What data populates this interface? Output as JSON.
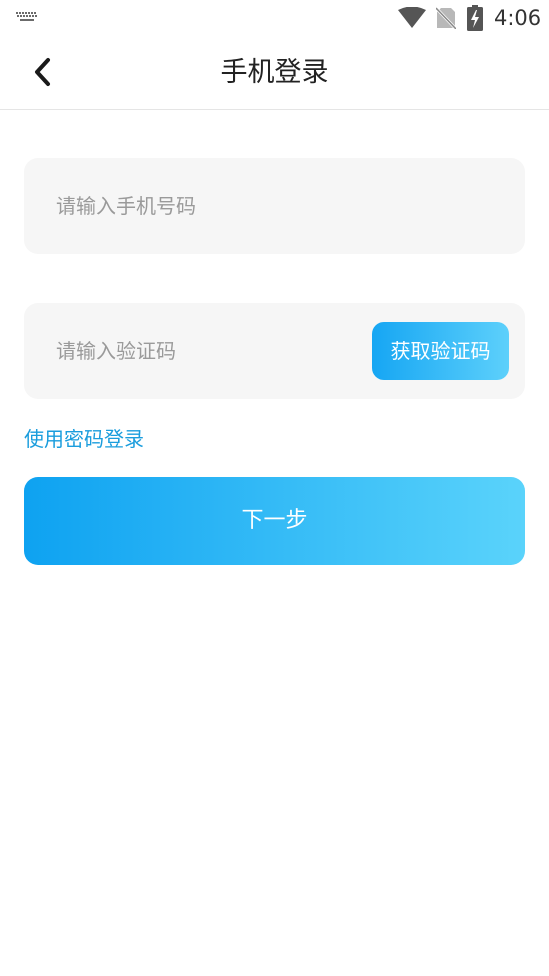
{
  "status_bar": {
    "time": "4:06",
    "icons": [
      "keyboard-icon",
      "wifi-icon",
      "no-sim-icon",
      "battery-charging-icon"
    ]
  },
  "nav": {
    "title": "手机登录",
    "back_icon": "chevron-left-icon"
  },
  "form": {
    "phone_placeholder": "请输入手机号码",
    "phone_value": "",
    "code_placeholder": "请输入验证码",
    "code_value": "",
    "get_code_label": "获取验证码",
    "password_login_link": "使用密码登录",
    "next_label": "下一步"
  },
  "colors": {
    "accent_start": "#0ea2f1",
    "accent_end": "#5ad3fb",
    "link": "#1a9ddd",
    "field_bg": "#f6f6f6"
  }
}
